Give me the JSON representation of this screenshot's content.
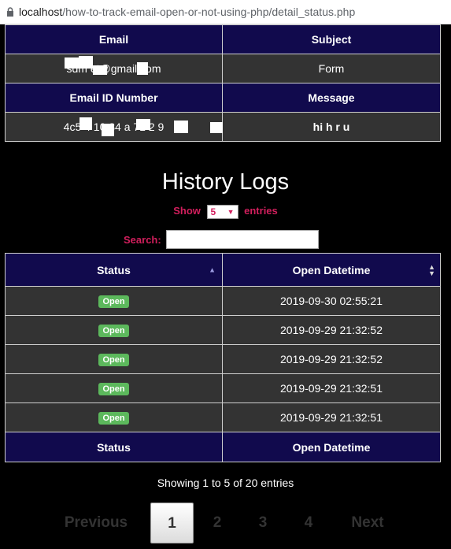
{
  "browser": {
    "host": "localhost",
    "path": "/how-to-track-email-open-or-not-using-php/detail_status.php"
  },
  "details": {
    "email_header": "Email",
    "subject_header": "Subject",
    "email_value": "sdm  et@gmail.com",
    "subject_value": "Form",
    "id_header": "Email ID Number",
    "message_header": "Message",
    "id_value": "4c5  4  10  84  a  71  2  9",
    "message_value": "hi h r u"
  },
  "history": {
    "title": "History Logs",
    "show_label": "Show",
    "show_value": "5",
    "entries_label": "entries",
    "search_label": "Search:",
    "search_value": "",
    "col_status": "Status",
    "col_datetime": "Open Datetime",
    "rows": [
      {
        "status": "Open",
        "datetime": "2019-09-30 02:55:21"
      },
      {
        "status": "Open",
        "datetime": "2019-09-29 21:32:52"
      },
      {
        "status": "Open",
        "datetime": "2019-09-29 21:32:52"
      },
      {
        "status": "Open",
        "datetime": "2019-09-29 21:32:51"
      },
      {
        "status": "Open",
        "datetime": "2019-09-29 21:32:51"
      }
    ],
    "footer_status": "Status",
    "footer_datetime": "Open Datetime",
    "info": "Showing 1 to 5 of 20 entries"
  },
  "pagination": {
    "previous": "Previous",
    "pages": [
      "1",
      "2",
      "3",
      "4"
    ],
    "next": "Next",
    "current": "1"
  },
  "colors": {
    "header_bg": "#110a4d",
    "cell_bg": "#333333",
    "accent": "#d21f5d",
    "badge": "#5cb85c"
  }
}
